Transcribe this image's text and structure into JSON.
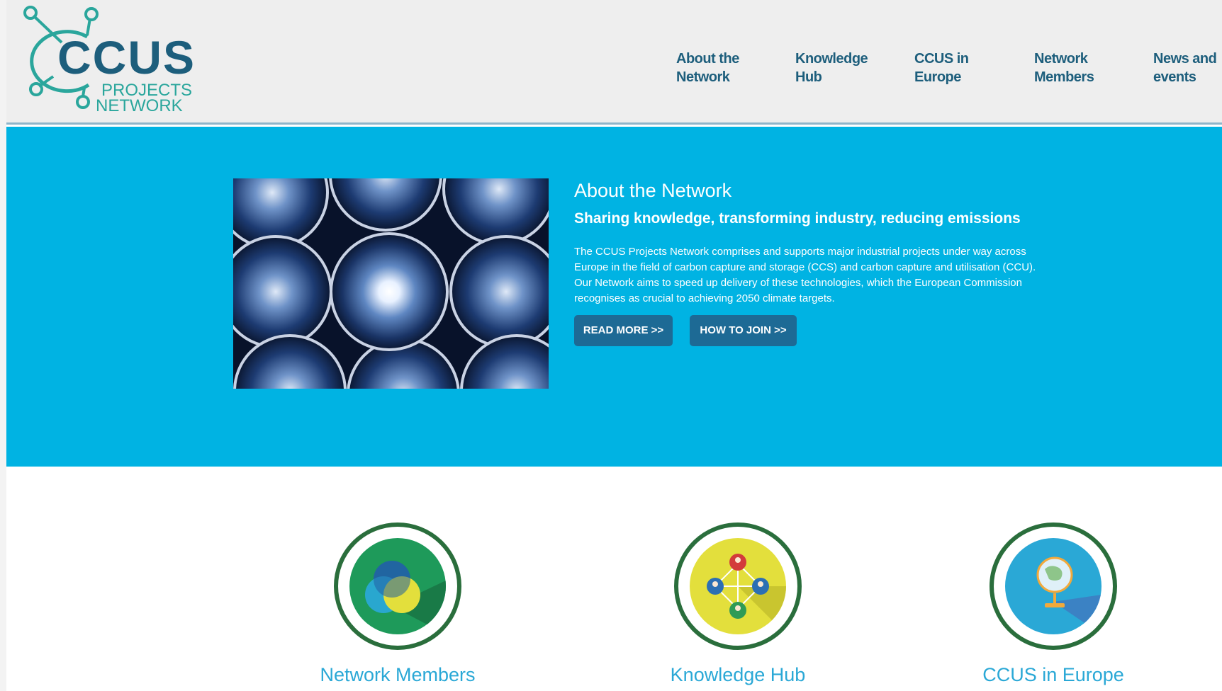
{
  "header": {
    "logo": {
      "line1": "CCUS",
      "line2": "PROJECTS",
      "line3": "NETWORK"
    },
    "nav": [
      {
        "line1": "About the",
        "line2": "Network"
      },
      {
        "line1": "Knowledge",
        "line2": "Hub"
      },
      {
        "line1": "CCUS in",
        "line2": "Europe"
      },
      {
        "line1": "Network",
        "line2": "Members"
      },
      {
        "line1": "News and",
        "line2": "events"
      }
    ]
  },
  "hero": {
    "title": "About the Network",
    "subtitle": "Sharing knowledge, transforming industry, reducing emissions",
    "body": "The CCUS Projects Network comprises and supports major industrial projects under way across Europe in the field of carbon capture and storage (CCS) and carbon capture and utilisation (CCU). Our Network aims to speed up delivery of these technologies, which the European Commission recognises as crucial to achieving 2050 climate targets.",
    "read_more": "READ MORE >>",
    "how_to_join": "HOW TO JOIN >>"
  },
  "tiles": [
    {
      "label": "Network Members",
      "icon": "overlapping-circles-icon",
      "color": "#1e9a5a"
    },
    {
      "label": "Knowledge Hub",
      "icon": "people-network-icon",
      "color": "#e3df3c"
    },
    {
      "label": "CCUS in Europe",
      "icon": "globe-icon",
      "color": "#2aa8d6"
    }
  ],
  "colors": {
    "hero_bg": "#00b3e3",
    "brand_dark": "#1d5e7c",
    "brand_green": "#2aa69c",
    "button": "#1d6a95",
    "tile_ring": "#2a6e3c",
    "tile_label": "#2aa8d6"
  }
}
